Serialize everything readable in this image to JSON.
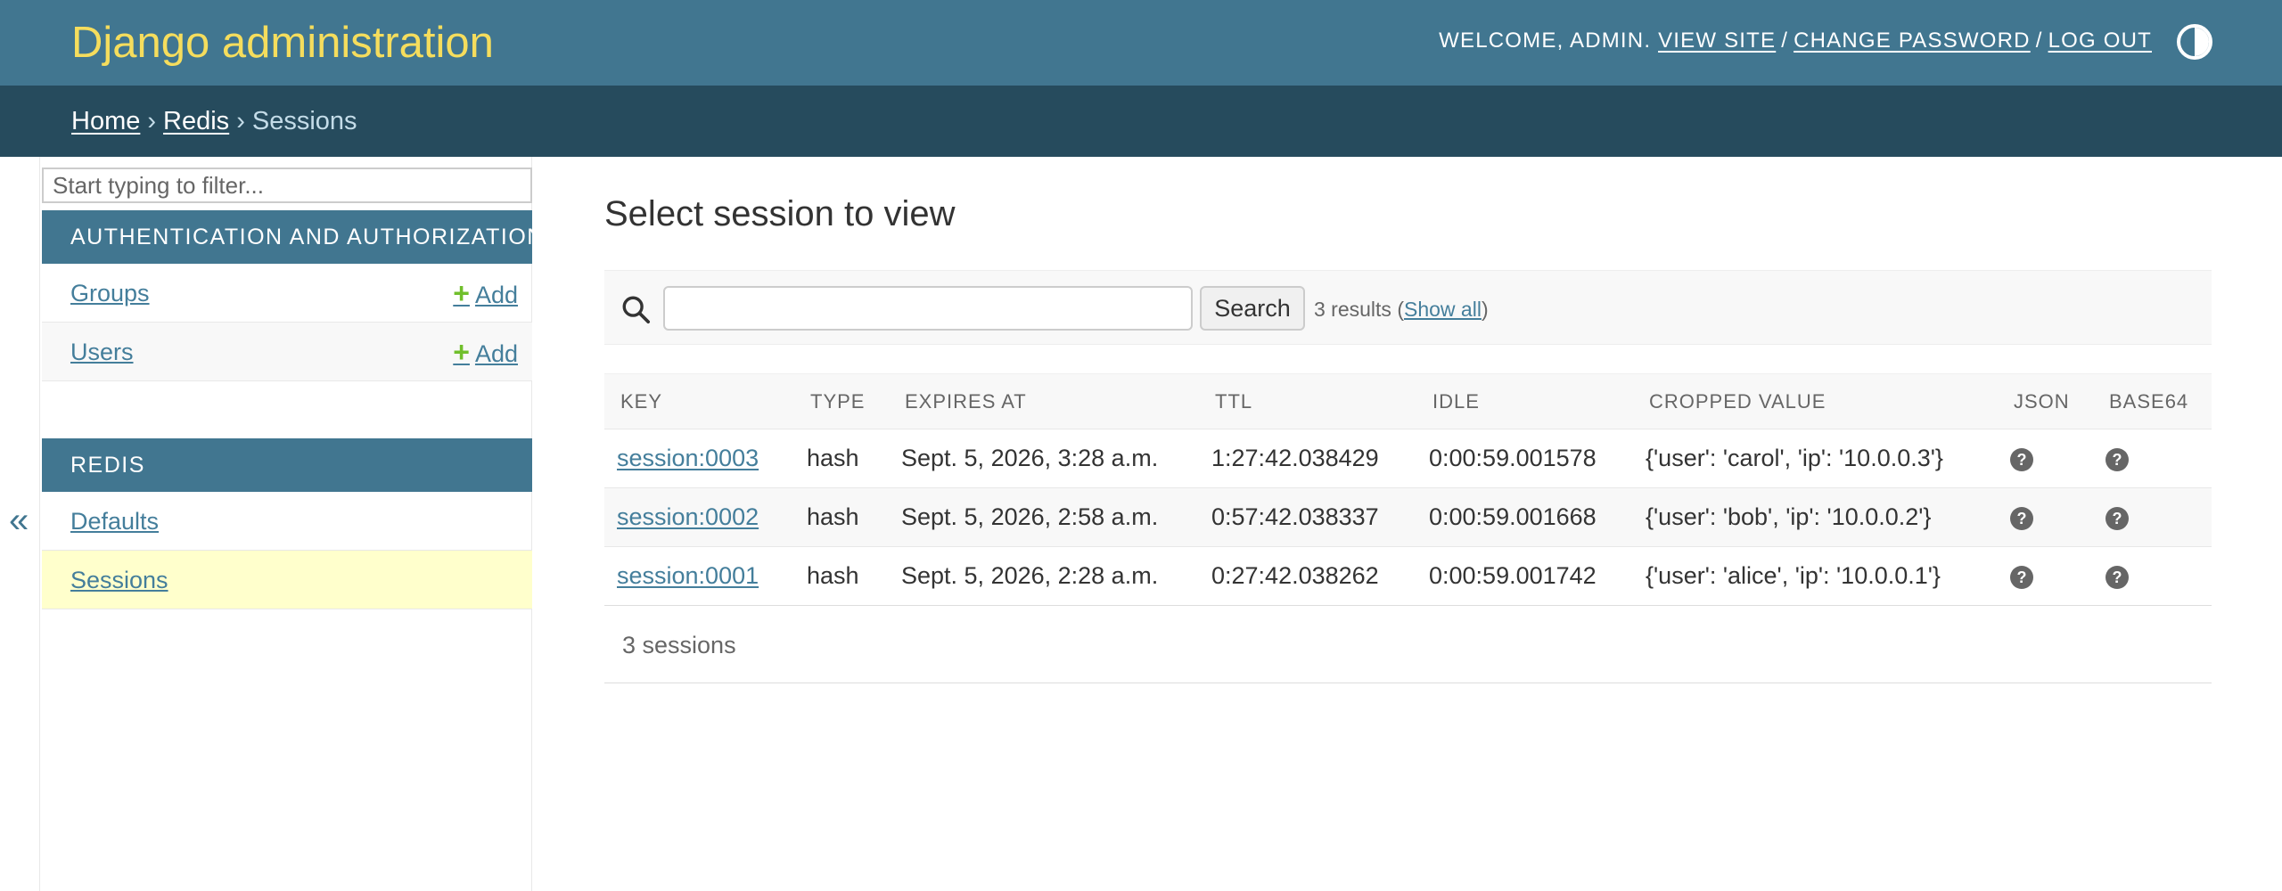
{
  "header": {
    "site_name": "Django administration",
    "welcome_prefix": "Welcome,",
    "username": "admin",
    "view_site": "View site",
    "change_password": "Change password",
    "log_out": "Log out",
    "theme_toggle_icon": "contrast-icon"
  },
  "breadcrumbs": {
    "home": "Home",
    "app": "Redis",
    "current": "Sessions",
    "separator": "›"
  },
  "sidebar": {
    "toggle_glyph": "«",
    "filter_placeholder": "Start typing to filter...",
    "modules": [
      {
        "caption": "Authentication and Authorization",
        "models": [
          {
            "label": "Groups",
            "add": "Add"
          },
          {
            "label": "Users",
            "add": "Add"
          }
        ]
      },
      {
        "caption": "Redis",
        "models": [
          {
            "label": "Defaults"
          },
          {
            "label": "Sessions",
            "current": true
          }
        ]
      }
    ]
  },
  "content": {
    "title": "Select session to view",
    "search": {
      "button": "Search",
      "results": "3 results",
      "show_all": "Show all"
    },
    "table": {
      "columns": [
        "Key",
        "Type",
        "Expires at",
        "TTL",
        "Idle",
        "Cropped value",
        "JSON",
        "Base64"
      ],
      "rows": [
        {
          "key": "session:0003",
          "type": "hash",
          "expires": "Sept. 5, 2026, 3:28 a.m.",
          "ttl": "1:27:42.038429",
          "idle": "0:00:59.001578",
          "value": "{'user': 'carol', 'ip': '10.0.0.3'}"
        },
        {
          "key": "session:0002",
          "type": "hash",
          "expires": "Sept. 5, 2026, 2:58 a.m.",
          "ttl": "0:57:42.038337",
          "idle": "0:00:59.001668",
          "value": "{'user': 'bob', 'ip': '10.0.0.2'}"
        },
        {
          "key": "session:0001",
          "type": "hash",
          "expires": "Sept. 5, 2026, 2:28 a.m.",
          "ttl": "0:27:42.038262",
          "idle": "0:00:59.001742",
          "value": "{'user': 'alice', 'ip': '10.0.0.1'}"
        }
      ],
      "help_glyph": "?"
    },
    "paginator": "3 sessions"
  },
  "colors": {
    "header": "#417690",
    "breadcrumbs": "#264b5d",
    "branding": "#f5dd5d",
    "link": "#447e9b",
    "add_plus": "#70bf2b",
    "current_row": "#ffffcc"
  }
}
